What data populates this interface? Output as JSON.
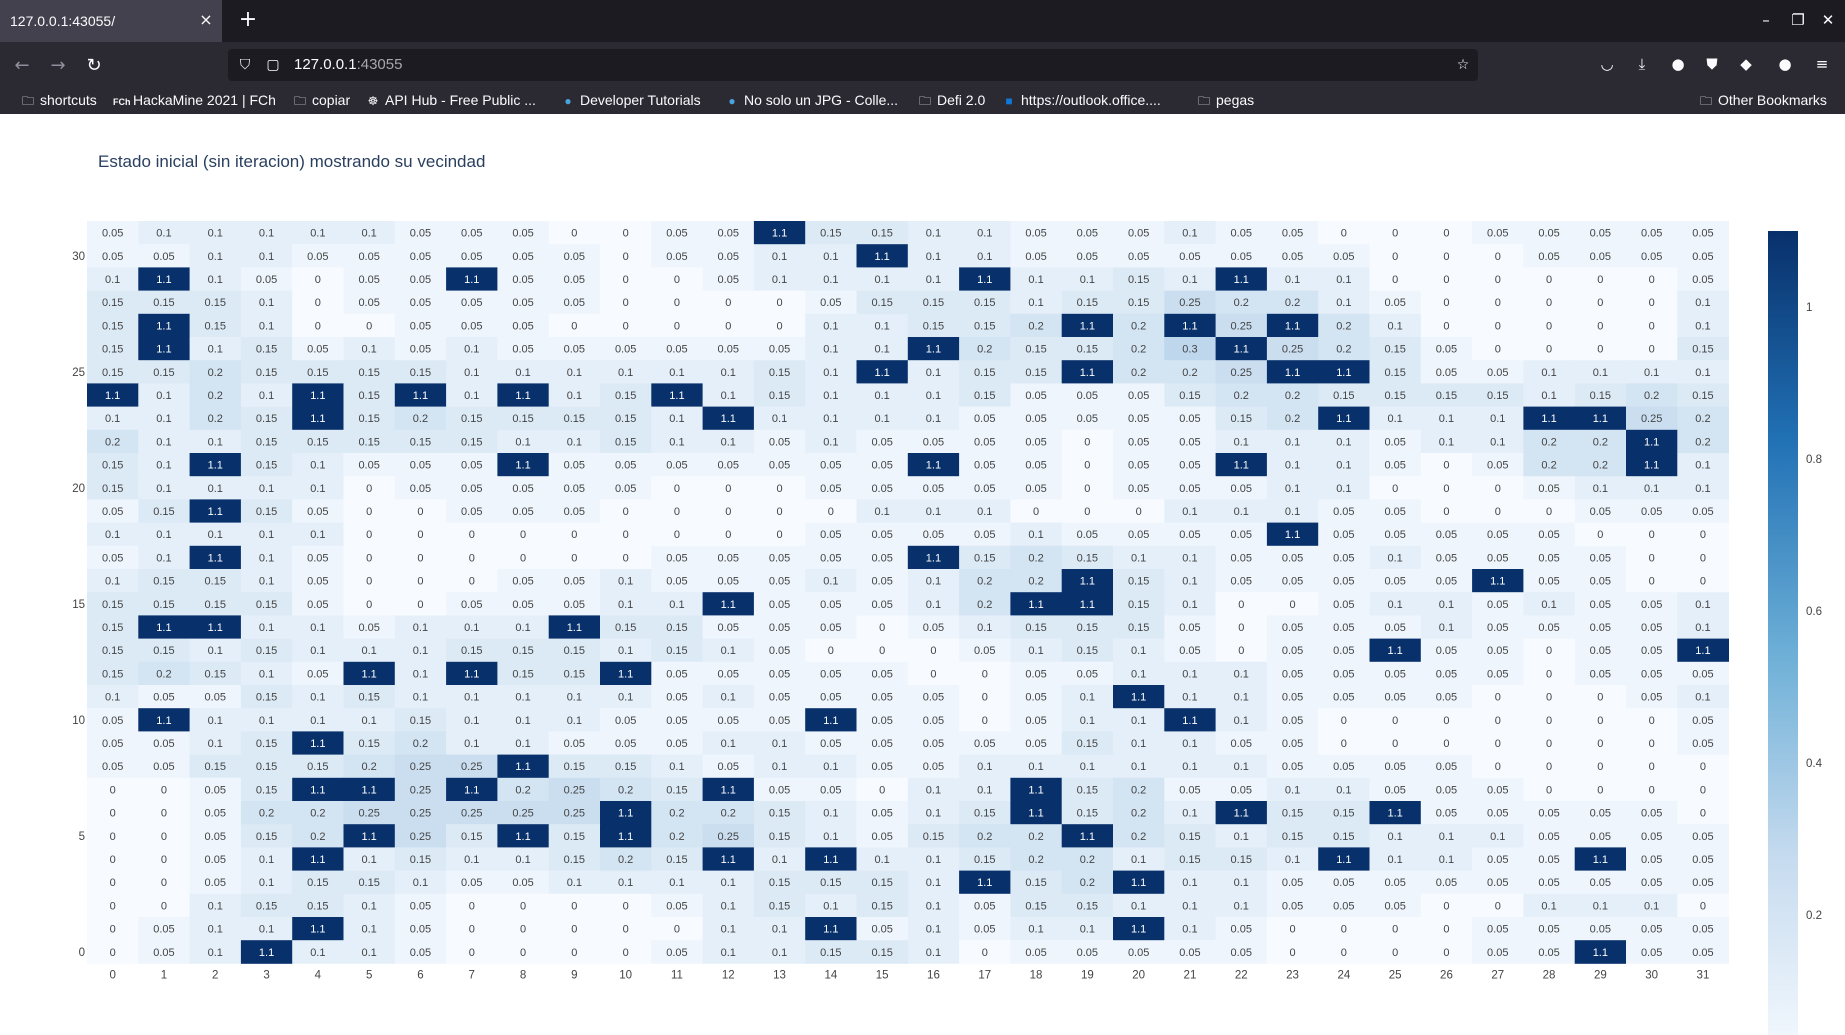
{
  "browser": {
    "tab_title": "127.0.0.1:43055/",
    "tab_close_icon": "×",
    "new_tab_icon": "+",
    "url_host": "127.0.0.1",
    "url_port": ":43055",
    "bookmarks": [
      {
        "label": "shortcuts",
        "icon": "folder-icon"
      },
      {
        "label": "HackaMine 2021 | FCh",
        "icon": "fch-icon"
      },
      {
        "label": "copiar",
        "icon": "folder-icon"
      },
      {
        "label": "API Hub - Free Public ...",
        "icon": "rapidapi-icon"
      },
      {
        "label": "Developer Tutorials",
        "icon": "globe-icon"
      },
      {
        "label": "No solo un JPG - Colle...",
        "icon": "globe-icon"
      },
      {
        "label": "Defi 2.0",
        "icon": "folder-icon"
      },
      {
        "label": "https://outlook.office....",
        "icon": "outlook-icon"
      },
      {
        "label": "pegas",
        "icon": "folder-icon"
      }
    ],
    "other_bookmarks": "Other Bookmarks"
  },
  "page": {
    "title": "Estado inicial (sin iteracion) mostrando su vecindad"
  },
  "chart_data": {
    "type": "heatmap",
    "title": "Estado inicial (sin iteracion) mostrando su vecindad",
    "x": [
      0,
      1,
      2,
      3,
      4,
      5,
      6,
      7,
      8,
      9,
      10,
      11,
      12,
      13,
      14,
      15,
      16,
      17,
      18,
      19,
      20,
      21,
      22,
      23,
      24,
      25,
      26,
      27,
      28,
      29,
      30,
      31
    ],
    "y_tick_labels": [
      "0",
      "5",
      "10",
      "15",
      "20",
      "25",
      "30"
    ],
    "x_tick_labels": [
      "0",
      "1",
      "2",
      "3",
      "4",
      "5",
      "6",
      "7",
      "8",
      "9",
      "10",
      "11",
      "12",
      "13",
      "14",
      "15",
      "16",
      "17",
      "18",
      "19",
      "20",
      "21",
      "22",
      "23",
      "24",
      "25",
      "26",
      "27",
      "28",
      "29",
      "30",
      "31"
    ],
    "colorscale": [
      "#f7fbff",
      "#08306b"
    ],
    "colorbar": {
      "ticks": [
        "0",
        "0.2",
        "0.4",
        "0.6",
        "0.8",
        "1"
      ],
      "range": [
        0,
        1.1
      ]
    },
    "z_rows_top_to_bottom": [
      [
        "0.05",
        "0.1",
        "0.1",
        "0.1",
        "0.1",
        "0.1",
        "0.05",
        "0.05",
        "0.05",
        "0",
        "0",
        "0.05",
        "0.05",
        "1.1",
        "0.15",
        "0.15",
        "0.1",
        "0.1",
        "0.05",
        "0.05",
        "0.05",
        "0.1",
        "0.05",
        "0.05",
        "0",
        "0",
        "0",
        "0.05",
        "0.05",
        "0.05",
        "0.05",
        "0.05"
      ],
      [
        "0.05",
        "0.05",
        "0.1",
        "0.1",
        "0.05",
        "0.05",
        "0.05",
        "0.05",
        "0.05",
        "0.05",
        "0",
        "0.05",
        "0.05",
        "0.1",
        "0.1",
        "1.1",
        "0.1",
        "0.1",
        "0.05",
        "0.05",
        "0.05",
        "0.05",
        "0.05",
        "0.05",
        "0.05",
        "0",
        "0",
        "0",
        "0.05",
        "0.05",
        "0.05",
        "0.05"
      ],
      [
        "0.1",
        "1.1",
        "0.1",
        "0.05",
        "0",
        "0.05",
        "0.05",
        "1.1",
        "0.05",
        "0.05",
        "0",
        "0",
        "0.05",
        "0.1",
        "0.1",
        "0.1",
        "0.1",
        "1.1",
        "0.1",
        "0.1",
        "0.15",
        "0.1",
        "1.1",
        "0.1",
        "0.1",
        "0",
        "0",
        "0",
        "0",
        "0",
        "0",
        "0.05"
      ],
      [
        "0.15",
        "0.15",
        "0.15",
        "0.1",
        "0",
        "0.05",
        "0.05",
        "0.05",
        "0.05",
        "0.05",
        "0",
        "0",
        "0",
        "0",
        "0.05",
        "0.15",
        "0.15",
        "0.15",
        "0.1",
        "0.15",
        "0.15",
        "0.25",
        "0.2",
        "0.2",
        "0.1",
        "0.05",
        "0",
        "0",
        "0",
        "0",
        "0",
        "0.1"
      ],
      [
        "0.15",
        "1.1",
        "0.15",
        "0.1",
        "0",
        "0",
        "0.05",
        "0.05",
        "0.05",
        "0",
        "0",
        "0",
        "0",
        "0",
        "0.1",
        "0.1",
        "0.15",
        "0.15",
        "0.2",
        "1.1",
        "0.2",
        "1.1",
        "0.25",
        "1.1",
        "0.2",
        "0.1",
        "0",
        "0",
        "0",
        "0",
        "0",
        "0.1"
      ],
      [
        "0.15",
        "1.1",
        "0.1",
        "0.15",
        "0.05",
        "0.1",
        "0.05",
        "0.1",
        "0.05",
        "0.05",
        "0.05",
        "0.05",
        "0.05",
        "0.05",
        "0.1",
        "0.1",
        "1.1",
        "0.2",
        "0.15",
        "0.15",
        "0.2",
        "0.3",
        "1.1",
        "0.25",
        "0.2",
        "0.15",
        "0.05",
        "0",
        "0",
        "0",
        "0",
        "0.15"
      ],
      [
        "0.15",
        "0.15",
        "0.2",
        "0.15",
        "0.15",
        "0.15",
        "0.15",
        "0.1",
        "0.1",
        "0.1",
        "0.1",
        "0.1",
        "0.1",
        "0.15",
        "0.1",
        "1.1",
        "0.1",
        "0.15",
        "0.15",
        "1.1",
        "0.2",
        "0.2",
        "0.25",
        "1.1",
        "1.1",
        "0.15",
        "0.05",
        "0.05",
        "0.1",
        "0.1",
        "0.1",
        "0.1"
      ],
      [
        "1.1",
        "0.1",
        "0.2",
        "0.1",
        "1.1",
        "0.15",
        "1.1",
        "0.1",
        "1.1",
        "0.1",
        "0.15",
        "1.1",
        "0.1",
        "0.15",
        "0.1",
        "0.1",
        "0.1",
        "0.15",
        "0.05",
        "0.05",
        "0.05",
        "0.15",
        "0.2",
        "0.2",
        "0.15",
        "0.15",
        "0.15",
        "0.15",
        "0.1",
        "0.15",
        "0.2",
        "0.15"
      ],
      [
        "0.1",
        "0.1",
        "0.2",
        "0.15",
        "1.1",
        "0.15",
        "0.2",
        "0.15",
        "0.15",
        "0.15",
        "0.15",
        "0.1",
        "1.1",
        "0.1",
        "0.1",
        "0.1",
        "0.1",
        "0.05",
        "0.05",
        "0.05",
        "0.05",
        "0.05",
        "0.15",
        "0.2",
        "1.1",
        "0.1",
        "0.1",
        "0.1",
        "1.1",
        "1.1",
        "0.25",
        "0.2"
      ],
      [
        "0.2",
        "0.1",
        "0.1",
        "0.15",
        "0.15",
        "0.15",
        "0.15",
        "0.15",
        "0.1",
        "0.1",
        "0.15",
        "0.1",
        "0.1",
        "0.05",
        "0.1",
        "0.05",
        "0.05",
        "0.05",
        "0.05",
        "0",
        "0.05",
        "0.05",
        "0.1",
        "0.1",
        "0.1",
        "0.05",
        "0.1",
        "0.1",
        "0.2",
        "0.2",
        "1.1",
        "0.2"
      ],
      [
        "0.15",
        "0.1",
        "1.1",
        "0.15",
        "0.1",
        "0.05",
        "0.05",
        "0.05",
        "1.1",
        "0.05",
        "0.05",
        "0.05",
        "0.05",
        "0.05",
        "0.05",
        "0.05",
        "1.1",
        "0.05",
        "0.05",
        "0",
        "0.05",
        "0.05",
        "1.1",
        "0.1",
        "0.1",
        "0.05",
        "0",
        "0.05",
        "0.2",
        "0.2",
        "1.1",
        "0.1"
      ],
      [
        "0.15",
        "0.1",
        "0.1",
        "0.1",
        "0.1",
        "0",
        "0.05",
        "0.05",
        "0.05",
        "0.05",
        "0.05",
        "0",
        "0",
        "0",
        "0.05",
        "0.05",
        "0.05",
        "0.05",
        "0.05",
        "0",
        "0.05",
        "0.05",
        "0.05",
        "0.1",
        "0.1",
        "0",
        "0",
        "0",
        "0.05",
        "0.1",
        "0.1",
        "0.1"
      ],
      [
        "0.05",
        "0.15",
        "1.1",
        "0.15",
        "0.05",
        "0",
        "0",
        "0.05",
        "0.05",
        "0.05",
        "0",
        "0",
        "0",
        "0",
        "0",
        "0.1",
        "0.1",
        "0.1",
        "0",
        "0",
        "0",
        "0.1",
        "0.1",
        "0.1",
        "0.05",
        "0.05",
        "0",
        "0",
        "0",
        "0.05",
        "0.05",
        "0.05"
      ],
      [
        "0.1",
        "0.1",
        "0.1",
        "0.1",
        "0.1",
        "0",
        "0",
        "0",
        "0",
        "0",
        "0",
        "0",
        "0",
        "0",
        "0.05",
        "0.05",
        "0.05",
        "0.05",
        "0.1",
        "0.05",
        "0.05",
        "0.05",
        "0.05",
        "1.1",
        "0.05",
        "0.05",
        "0.05",
        "0.05",
        "0.05",
        "0",
        "0",
        "0"
      ],
      [
        "0.05",
        "0.1",
        "1.1",
        "0.1",
        "0.05",
        "0",
        "0",
        "0",
        "0",
        "0",
        "0",
        "0.05",
        "0.05",
        "0.05",
        "0.05",
        "0.05",
        "1.1",
        "0.15",
        "0.2",
        "0.15",
        "0.1",
        "0.1",
        "0.05",
        "0.05",
        "0.05",
        "0.1",
        "0.05",
        "0.05",
        "0.05",
        "0.05",
        "0",
        "0"
      ],
      [
        "0.1",
        "0.15",
        "0.15",
        "0.1",
        "0.05",
        "0",
        "0",
        "0",
        "0.05",
        "0.05",
        "0.1",
        "0.05",
        "0.05",
        "0.05",
        "0.1",
        "0.05",
        "0.1",
        "0.2",
        "0.2",
        "1.1",
        "0.15",
        "0.1",
        "0.05",
        "0.05",
        "0.05",
        "0.05",
        "0.05",
        "1.1",
        "0.05",
        "0.05",
        "0",
        "0"
      ],
      [
        "0.15",
        "0.15",
        "0.15",
        "0.15",
        "0.05",
        "0",
        "0",
        "0.05",
        "0.05",
        "0.05",
        "0.1",
        "0.1",
        "1.1",
        "0.05",
        "0.05",
        "0.05",
        "0.1",
        "0.2",
        "1.1",
        "1.1",
        "0.15",
        "0.1",
        "0",
        "0",
        "0.05",
        "0.1",
        "0.1",
        "0.05",
        "0.1",
        "0.05",
        "0.05",
        "0.1"
      ],
      [
        "0.15",
        "1.1",
        "1.1",
        "0.1",
        "0.1",
        "0.05",
        "0.1",
        "0.1",
        "0.1",
        "1.1",
        "0.15",
        "0.15",
        "0.05",
        "0.05",
        "0.05",
        "0",
        "0.05",
        "0.1",
        "0.15",
        "0.15",
        "0.15",
        "0.05",
        "0",
        "0.05",
        "0.05",
        "0.05",
        "0.1",
        "0.05",
        "0.05",
        "0.05",
        "0.05",
        "0.1"
      ],
      [
        "0.15",
        "0.15",
        "0.1",
        "0.15",
        "0.1",
        "0.1",
        "0.1",
        "0.15",
        "0.15",
        "0.15",
        "0.1",
        "0.15",
        "0.1",
        "0.05",
        "0",
        "0",
        "0",
        "0.05",
        "0.1",
        "0.15",
        "0.1",
        "0.05",
        "0",
        "0.05",
        "0.05",
        "1.1",
        "0.05",
        "0.05",
        "0",
        "0.05",
        "0.05",
        "1.1"
      ],
      [
        "0.15",
        "0.2",
        "0.15",
        "0.1",
        "0.05",
        "1.1",
        "0.1",
        "1.1",
        "0.15",
        "0.15",
        "1.1",
        "0.05",
        "0.05",
        "0.05",
        "0.05",
        "0.05",
        "0",
        "0",
        "0.05",
        "0.05",
        "0.1",
        "0.1",
        "0.1",
        "0.05",
        "0.05",
        "0.05",
        "0.05",
        "0.05",
        "0",
        "0.05",
        "0.05",
        "0.05"
      ],
      [
        "0.1",
        "0.05",
        "0.05",
        "0.15",
        "0.1",
        "0.15",
        "0.1",
        "0.1",
        "0.1",
        "0.1",
        "0.1",
        "0.05",
        "0.1",
        "0.05",
        "0.05",
        "0.05",
        "0.05",
        "0",
        "0.05",
        "0.1",
        "1.1",
        "0.1",
        "0.1",
        "0.05",
        "0.05",
        "0.05",
        "0.05",
        "0",
        "0",
        "0",
        "0.05",
        "0.1"
      ],
      [
        "0.05",
        "1.1",
        "0.1",
        "0.1",
        "0.1",
        "0.1",
        "0.15",
        "0.1",
        "0.1",
        "0.1",
        "0.05",
        "0.05",
        "0.05",
        "0.05",
        "1.1",
        "0.05",
        "0.05",
        "0",
        "0.05",
        "0.1",
        "0.1",
        "1.1",
        "0.1",
        "0.05",
        "0",
        "0",
        "0",
        "0",
        "0",
        "0",
        "0",
        "0.05"
      ],
      [
        "0.05",
        "0.05",
        "0.1",
        "0.15",
        "1.1",
        "0.15",
        "0.2",
        "0.1",
        "0.1",
        "0.05",
        "0.05",
        "0.05",
        "0.1",
        "0.1",
        "0.05",
        "0.05",
        "0.05",
        "0.05",
        "0.05",
        "0.15",
        "0.1",
        "0.1",
        "0.05",
        "0.05",
        "0",
        "0",
        "0",
        "0",
        "0",
        "0",
        "0",
        "0.05"
      ],
      [
        "0.05",
        "0.05",
        "0.15",
        "0.15",
        "0.15",
        "0.2",
        "0.25",
        "0.25",
        "1.1",
        "0.15",
        "0.15",
        "0.1",
        "0.05",
        "0.1",
        "0.1",
        "0.05",
        "0.05",
        "0.1",
        "0.1",
        "0.1",
        "0.1",
        "0.1",
        "0.1",
        "0.05",
        "0.05",
        "0.05",
        "0.05",
        "0",
        "0",
        "0",
        "0",
        "0"
      ],
      [
        "0",
        "0",
        "0.05",
        "0.15",
        "1.1",
        "1.1",
        "0.25",
        "1.1",
        "0.2",
        "0.25",
        "0.2",
        "0.15",
        "1.1",
        "0.05",
        "0.05",
        "0",
        "0.1",
        "0.1",
        "1.1",
        "0.15",
        "0.2",
        "0.05",
        "0.05",
        "0.1",
        "0.1",
        "0.05",
        "0.05",
        "0.05",
        "0",
        "0",
        "0",
        "0"
      ],
      [
        "0",
        "0",
        "0.05",
        "0.2",
        "0.2",
        "0.25",
        "0.25",
        "0.25",
        "0.25",
        "0.25",
        "1.1",
        "0.2",
        "0.2",
        "0.15",
        "0.1",
        "0.05",
        "0.1",
        "0.15",
        "1.1",
        "0.15",
        "0.2",
        "0.1",
        "1.1",
        "0.15",
        "0.15",
        "1.1",
        "0.05",
        "0.05",
        "0.05",
        "0.05",
        "0.05",
        "0"
      ],
      [
        "0",
        "0",
        "0.05",
        "0.15",
        "0.2",
        "1.1",
        "0.25",
        "0.15",
        "1.1",
        "0.15",
        "1.1",
        "0.2",
        "0.25",
        "0.15",
        "0.1",
        "0.05",
        "0.15",
        "0.2",
        "0.2",
        "1.1",
        "0.2",
        "0.15",
        "0.1",
        "0.15",
        "0.15",
        "0.1",
        "0.1",
        "0.1",
        "0.05",
        "0.05",
        "0.05",
        "0.05"
      ],
      [
        "0",
        "0",
        "0.05",
        "0.1",
        "1.1",
        "0.1",
        "0.15",
        "0.1",
        "0.1",
        "0.15",
        "0.2",
        "0.15",
        "1.1",
        "0.1",
        "1.1",
        "0.1",
        "0.1",
        "0.15",
        "0.2",
        "0.2",
        "0.1",
        "0.15",
        "0.15",
        "0.1",
        "1.1",
        "0.1",
        "0.1",
        "0.05",
        "0.05",
        "1.1",
        "0.05",
        "0.05"
      ],
      [
        "0",
        "0",
        "0.05",
        "0.1",
        "0.15",
        "0.15",
        "0.1",
        "0.05",
        "0.05",
        "0.1",
        "0.1",
        "0.1",
        "0.1",
        "0.15",
        "0.15",
        "0.15",
        "0.1",
        "1.1",
        "0.15",
        "0.2",
        "1.1",
        "0.1",
        "0.1",
        "0.05",
        "0.05",
        "0.05",
        "0.05",
        "0.05",
        "0.05",
        "0.05",
        "0.05",
        "0.05"
      ],
      [
        "0",
        "0",
        "0.1",
        "0.15",
        "0.15",
        "0.1",
        "0.05",
        "0",
        "0",
        "0",
        "0",
        "0.05",
        "0.1",
        "0.15",
        "0.1",
        "0.15",
        "0.1",
        "0.05",
        "0.15",
        "0.15",
        "0.1",
        "0.1",
        "0.1",
        "0.05",
        "0.05",
        "0.05",
        "0",
        "0",
        "0.1",
        "0.1",
        "0.1",
        "0"
      ],
      [
        "0",
        "0.05",
        "0.1",
        "0.1",
        "1.1",
        "0.1",
        "0.05",
        "0",
        "0",
        "0",
        "0",
        "0",
        "0.1",
        "0.1",
        "1.1",
        "0.05",
        "0.1",
        "0.05",
        "0.1",
        "0.1",
        "1.1",
        "0.1",
        "0.05",
        "0",
        "0",
        "0",
        "0",
        "0.05",
        "0.05",
        "0.05",
        "0.05",
        "0.05"
      ],
      [
        "0",
        "0.05",
        "0.1",
        "1.1",
        "0.1",
        "0.1",
        "0.05",
        "0",
        "0",
        "0",
        "0",
        "0.05",
        "0.1",
        "0.1",
        "0.15",
        "0.15",
        "0.1",
        "0",
        "0.05",
        "0.05",
        "0.05",
        "0.05",
        "0.05",
        "0",
        "0",
        "0",
        "0",
        "0.05",
        "0.05",
        "1.1",
        "0.05",
        "0.05"
      ]
    ]
  }
}
